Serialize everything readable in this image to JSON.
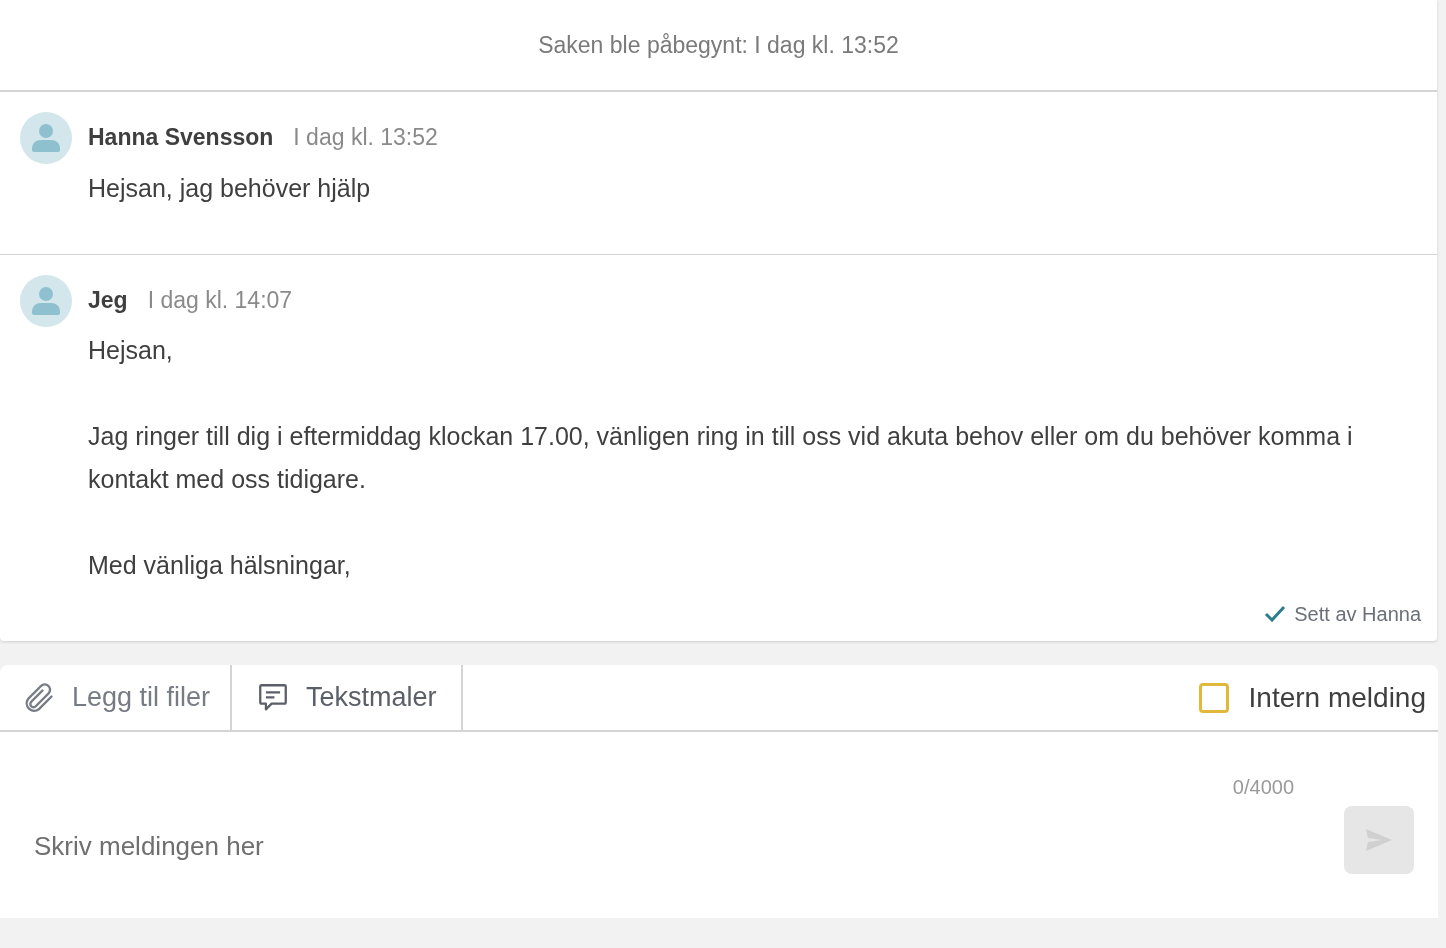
{
  "started": "Saken ble påbegynt: I dag kl. 13:52",
  "messages": [
    {
      "author": "Hanna Svensson",
      "time": "I dag kl. 13:52",
      "paragraphs": [
        "Hejsan, jag behöver hjälp"
      ]
    },
    {
      "author": "Jeg",
      "time": "I dag kl. 14:07",
      "paragraphs": [
        "Hejsan,",
        "Jag ringer till dig i eftermiddag klockan 17.00, vänligen ring in till oss vid akuta behov eller om du behöver komma i kontakt med oss tidigare.",
        "Med vänliga hälsningar,"
      ],
      "seen": "Sett av Hanna"
    }
  ],
  "composer": {
    "attach": "Legg til filer",
    "templates": "Tekstmaler",
    "internal": {
      "label": "Intern melding",
      "checked": false
    },
    "placeholder": "Skriv meldingen her",
    "counter": "0/4000",
    "send_disabled": true
  }
}
